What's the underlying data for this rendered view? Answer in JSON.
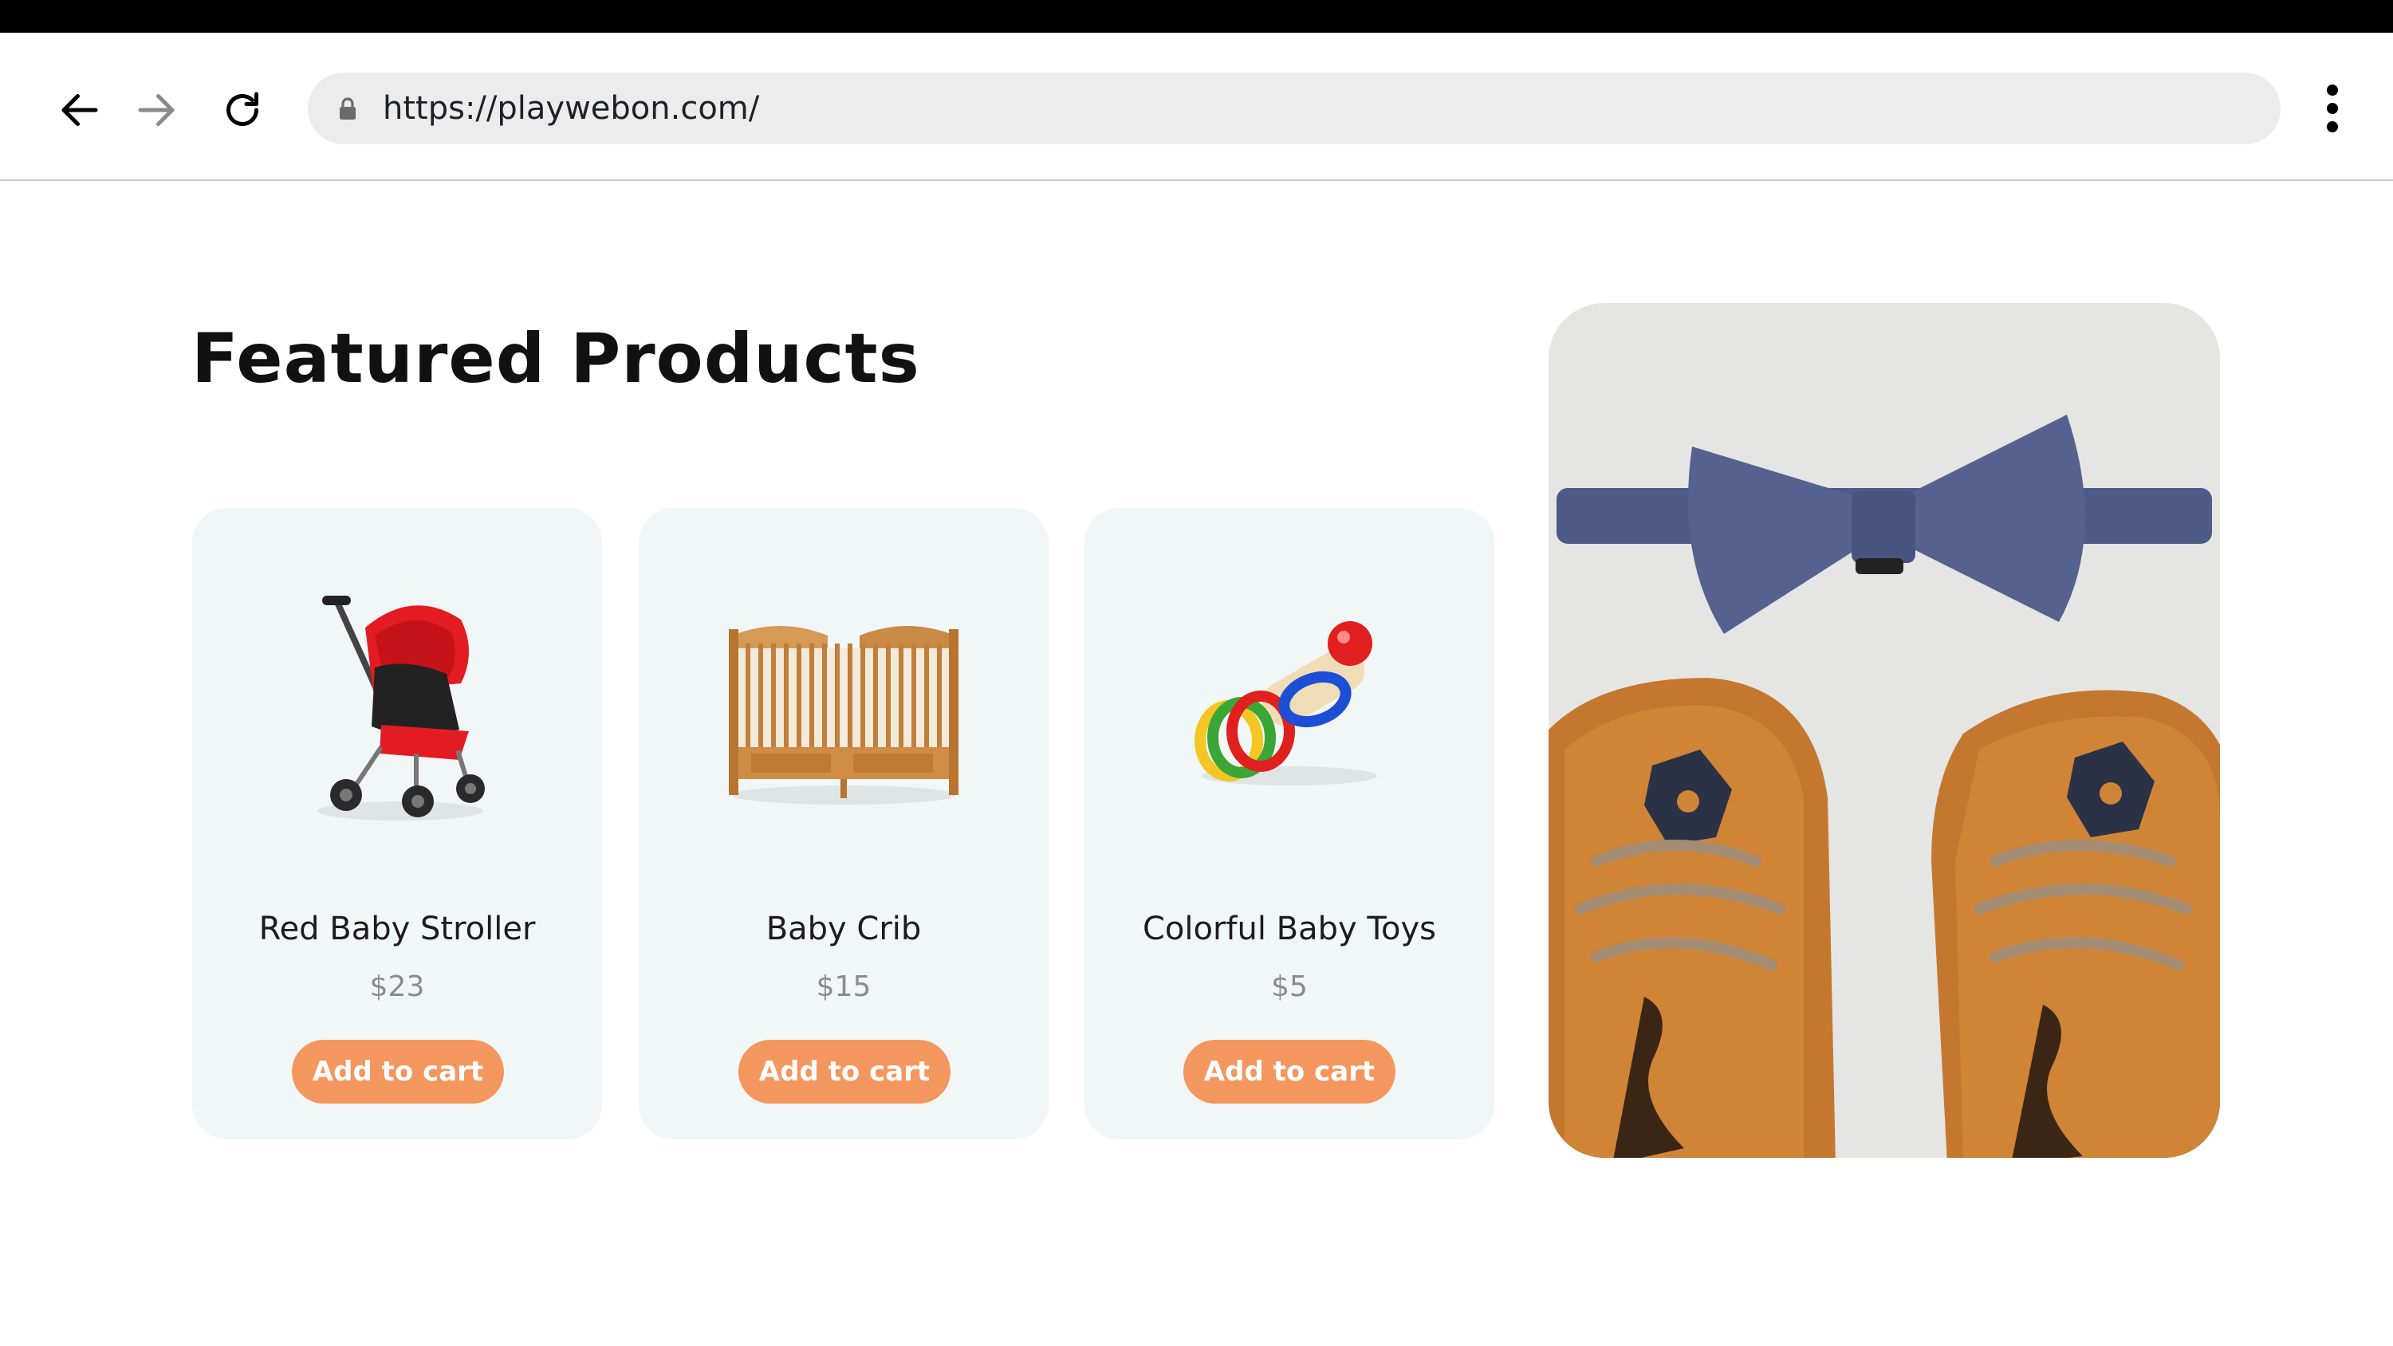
{
  "browser": {
    "url": "https://playwebon.com/",
    "back_icon": "arrow-left-icon",
    "forward_icon": "arrow-right-icon",
    "reload_icon": "reload-icon",
    "lock_icon": "lock-icon",
    "menu_icon": "more-vertical-icon"
  },
  "main": {
    "title": "Featured Products",
    "products": [
      {
        "name": "Red Baby Stroller",
        "price": "$23",
        "button": "Add to cart",
        "image": "stroller"
      },
      {
        "name": "Baby Crib",
        "price": "$15",
        "button": "Add to cart",
        "image": "crib"
      },
      {
        "name": "Colorful Baby Toys",
        "price": "$5",
        "button": "Add to cart",
        "image": "rings-toy"
      }
    ],
    "hero_image": "bow-tie-and-baby-shoes"
  },
  "colors": {
    "accent": "#f4975e",
    "card_bg": "#f1f6f6",
    "price": "#8b8b8b"
  }
}
